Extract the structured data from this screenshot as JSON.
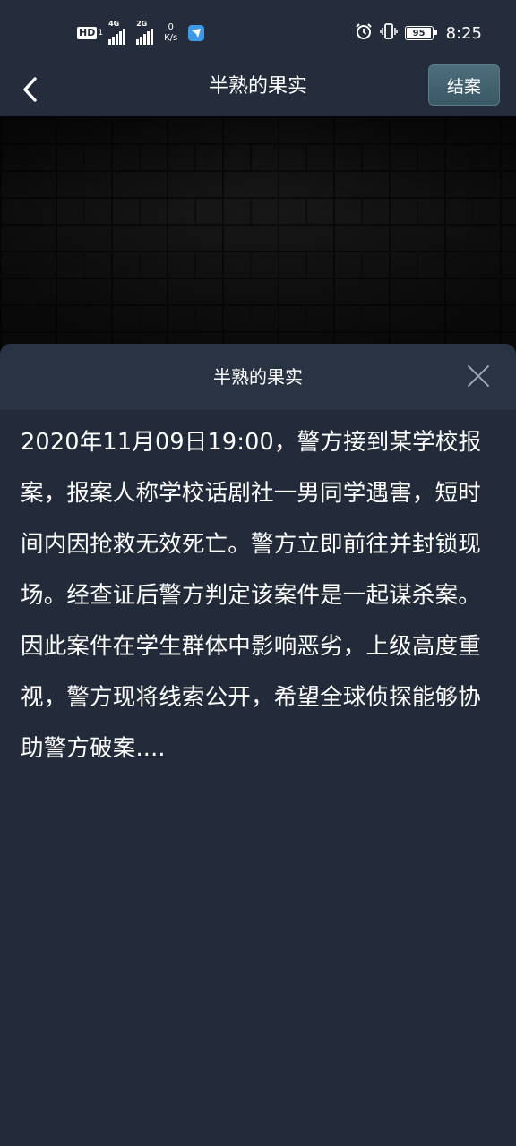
{
  "status_bar": {
    "hd_label": "HD",
    "hd_sub": "1",
    "net1": "4G",
    "net2": "2G",
    "speed_value": "0",
    "speed_unit": "K/s",
    "battery_level": "95",
    "time": "8:25"
  },
  "header": {
    "title": "半熟的果实",
    "close_case_label": "结案"
  },
  "sheet": {
    "title": "半熟的果实",
    "body": "2020年11月09日19:00，警方接到某学校报案，报案人称学校话剧社一男同学遇害，短时间内因抢救无效死亡。警方立即前往并封锁现场。经查证后警方判定该案件是一起谋杀案。因此案件在学生群体中影响恶劣，上级高度重视，警方现将线索公开，希望全球侦探能够协助警方破案...."
  },
  "icons": {
    "back": "chevron-left-icon",
    "close": "close-icon",
    "alarm": "alarm-icon",
    "vibrate": "vibrate-icon",
    "battery": "battery-icon"
  },
  "colors": {
    "background": "#232b3a",
    "header": "#252c3b",
    "sheet_header": "#2a3344",
    "button": "#4a6a78"
  }
}
